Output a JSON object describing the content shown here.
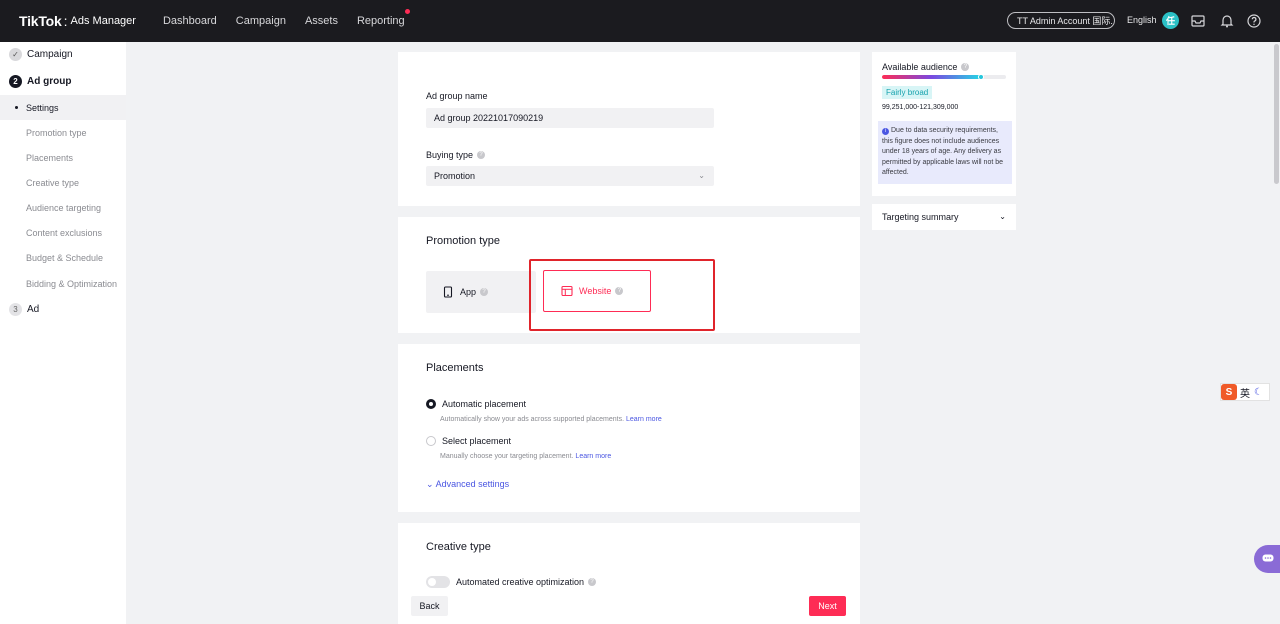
{
  "topbar": {
    "logo_main": "TikTok",
    "logo_sub": "Ads Manager",
    "nav": [
      "Dashboard",
      "Campaign",
      "Assets",
      "Reporting"
    ],
    "account": "TT Admin Account 国际...",
    "language": "English",
    "avatar_text": "任"
  },
  "sidebar": {
    "step1": {
      "number": "✓",
      "label": "Campaign"
    },
    "step2": {
      "number": "2",
      "label": "Ad group"
    },
    "step3": {
      "number": "3",
      "label": "Ad"
    },
    "sub_items": [
      "Settings",
      "Promotion type",
      "Placements",
      "Creative type",
      "Audience targeting",
      "Content exclusions",
      "Budget & Schedule",
      "Bidding & Optimization"
    ]
  },
  "settings_card": {
    "name_label": "Ad group name",
    "name_value": "Ad group 20221017090219",
    "buying_type_label": "Buying type",
    "buying_type_value": "Promotion"
  },
  "promotion_card": {
    "title": "Promotion type",
    "option_app": "App",
    "option_website": "Website",
    "selected": "Website"
  },
  "placements_card": {
    "title": "Placements",
    "auto_label": "Automatic placement",
    "auto_desc": "Automatically show your ads across supported placements.",
    "select_label": "Select placement",
    "select_desc": "Manually choose your targeting placement.",
    "learn_more": "Learn more",
    "advanced": "Advanced settings"
  },
  "creative_card": {
    "title": "Creative type",
    "toggle_label": "Automated creative optimization"
  },
  "footer": {
    "back": "Back",
    "next": "Next"
  },
  "audience": {
    "title": "Available audience",
    "badge": "Fairly broad",
    "range": "99,251,000-121,309,000",
    "level": 0.8,
    "note": "Due to data security requirements, this figure does not include audiences under 18 years of age. Any delivery as permitted by applicable laws will not be affected."
  },
  "summary": {
    "title": "Targeting summary"
  },
  "ime": {
    "s": "S",
    "char": "英"
  },
  "colors": {
    "brand": "#fe2c55",
    "link": "#4a56e2",
    "topbar": "#1b1b1f",
    "highlight": "#e0242b"
  }
}
